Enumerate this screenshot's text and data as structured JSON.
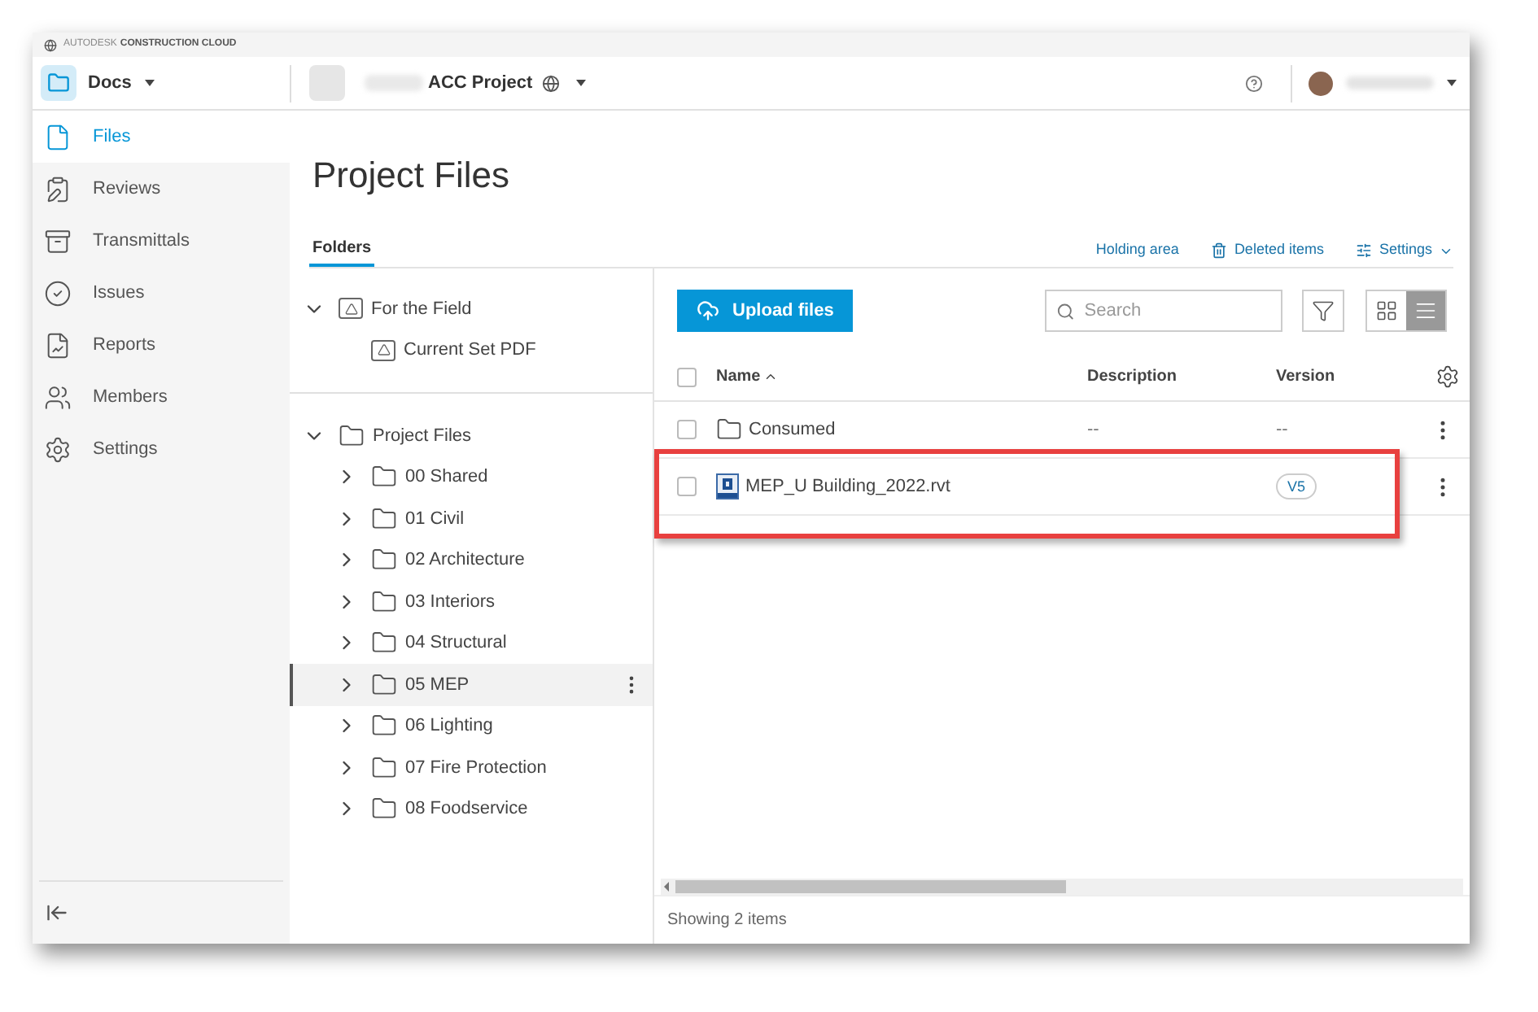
{
  "brand": {
    "prefix": "AUTODESK",
    "name": "CONSTRUCTION CLOUD"
  },
  "header": {
    "module": "Docs",
    "project": "ACC Project"
  },
  "sidebar": {
    "items": [
      {
        "label": "Files",
        "selected": true
      },
      {
        "label": "Reviews",
        "selected": false
      },
      {
        "label": "Transmittals",
        "selected": false
      },
      {
        "label": "Issues",
        "selected": false
      },
      {
        "label": "Reports",
        "selected": false
      },
      {
        "label": "Members",
        "selected": false
      },
      {
        "label": "Settings",
        "selected": false
      }
    ]
  },
  "page_title": "Project Files",
  "tabs": [
    {
      "label": "Folders",
      "selected": true
    }
  ],
  "tab_links": [
    {
      "kind": "holding",
      "label": "Holding area"
    },
    {
      "kind": "deleted",
      "label": "Deleted items"
    },
    {
      "kind": "settings",
      "label": "Settings"
    }
  ],
  "tree": [
    {
      "label": "For the Field",
      "kind": "field",
      "expanded": true,
      "selected": false,
      "children": [
        {
          "label": "Current Set PDF",
          "kind": "field",
          "selected": false
        }
      ]
    },
    {
      "label": "Project Files",
      "kind": "folder",
      "expanded": true,
      "selected": false,
      "children": [
        {
          "label": "00 Shared",
          "kind": "folder",
          "expanded": false,
          "selected": false
        },
        {
          "label": "01 Civil",
          "kind": "folder",
          "expanded": false,
          "selected": false
        },
        {
          "label": "02 Architecture",
          "kind": "folder",
          "expanded": false,
          "selected": false
        },
        {
          "label": "03 Interiors",
          "kind": "folder",
          "expanded": false,
          "selected": false
        },
        {
          "label": "04 Structural",
          "kind": "folder",
          "expanded": false,
          "selected": false
        },
        {
          "label": "05 MEP",
          "kind": "folder",
          "expanded": false,
          "selected": true
        },
        {
          "label": "06 Lighting",
          "kind": "folder",
          "expanded": false,
          "selected": false
        },
        {
          "label": "07 Fire Protection",
          "kind": "folder",
          "expanded": false,
          "selected": false
        },
        {
          "label": "08 Foodservice",
          "kind": "folder",
          "expanded": false,
          "selected": false
        }
      ]
    }
  ],
  "toolbar": {
    "upload": "Upload files",
    "search": {
      "placeholder": "Search"
    },
    "view_buttons": [
      {
        "kind": "grid",
        "selected": false
      },
      {
        "kind": "list",
        "selected": true
      }
    ]
  },
  "table": {
    "all_checked": false,
    "columns": [
      {
        "label": "Name",
        "sorted_ascending": true
      },
      {
        "label": "Description"
      },
      {
        "label": "Version"
      }
    ],
    "rows": [
      {
        "kind": "folder",
        "name": "Consumed",
        "description": "--",
        "version": "--",
        "checked": false,
        "highlighted": false
      },
      {
        "kind": "file",
        "name": "MEP_U Building_2022.rvt",
        "version": "V5",
        "checked": false,
        "highlighted": true
      }
    ]
  },
  "status_bar": "Showing 2 items"
}
